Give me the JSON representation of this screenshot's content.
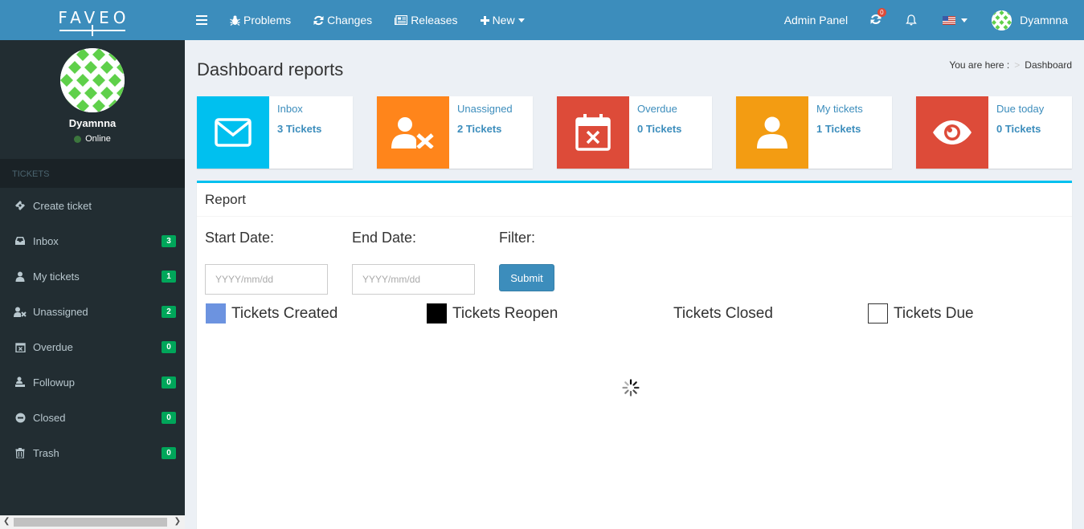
{
  "brand": {
    "logo_text": "FAVEO"
  },
  "sidebar": {
    "user_name": "Dyamnna",
    "user_status": "Online",
    "section_header": "TICKETS",
    "items": [
      {
        "label": "Create ticket",
        "icon": "ticket-icon"
      },
      {
        "label": "Inbox",
        "icon": "inbox-icon",
        "badge": "3"
      },
      {
        "label": "My tickets",
        "icon": "user-icon",
        "badge": "1"
      },
      {
        "label": "Unassigned",
        "icon": "user-times-icon",
        "badge": "2"
      },
      {
        "label": "Overdue",
        "icon": "calendar-times-icon",
        "badge": "0"
      },
      {
        "label": "Followup",
        "icon": "followup-icon",
        "badge": "0"
      },
      {
        "label": "Closed",
        "icon": "minus-circle-icon",
        "badge": "0"
      },
      {
        "label": "Trash",
        "icon": "trash-icon",
        "badge": "0"
      }
    ]
  },
  "topbar": {
    "nav": [
      {
        "label": "Problems",
        "icon": "bug-icon"
      },
      {
        "label": "Changes",
        "icon": "refresh-icon"
      },
      {
        "label": "Releases",
        "icon": "newspaper-icon"
      },
      {
        "label": "New",
        "icon": "plus-icon"
      }
    ],
    "admin_panel": "Admin Panel",
    "sync_badge": "0",
    "user_name": "Dyamnna"
  },
  "page": {
    "title": "Dashboard reports",
    "breadcrumb_prefix": "You are here :",
    "breadcrumb_current": "Dashboard"
  },
  "info_boxes": [
    {
      "title": "Inbox",
      "count": "3 Tickets",
      "color": "#00c0ef",
      "icon": "envelope-icon"
    },
    {
      "title": "Unassigned",
      "count": "2 Tickets",
      "color": "#ff851b",
      "icon": "user-times-icon"
    },
    {
      "title": "Overdue",
      "count": "0 Tickets",
      "color": "#dd4b39",
      "icon": "calendar-times-icon"
    },
    {
      "title": "My tickets",
      "count": "1 Tickets",
      "color": "#f39c12",
      "icon": "user-icon"
    },
    {
      "title": "Due today",
      "count": "0 Tickets",
      "color": "#dd4b39",
      "icon": "eye-icon"
    }
  ],
  "report": {
    "title": "Report",
    "start_label": "Start Date:",
    "end_label": "End Date:",
    "filter_label": "Filter:",
    "start_placeholder": "YYYY/mm/dd",
    "end_placeholder": "YYYY/mm/dd",
    "submit_label": "Submit",
    "legend": [
      {
        "label": "Tickets Created",
        "color": "#6c93e0"
      },
      {
        "label": "Tickets Reopen",
        "color": "#000000"
      },
      {
        "label": "Tickets Closed",
        "color": "#ffffff"
      },
      {
        "label": "Tickets Due",
        "color": "#ffffff"
      }
    ]
  },
  "colors": {
    "primary": "#3c8dbc",
    "sidebar": "#222d32",
    "success": "#00a65a"
  }
}
